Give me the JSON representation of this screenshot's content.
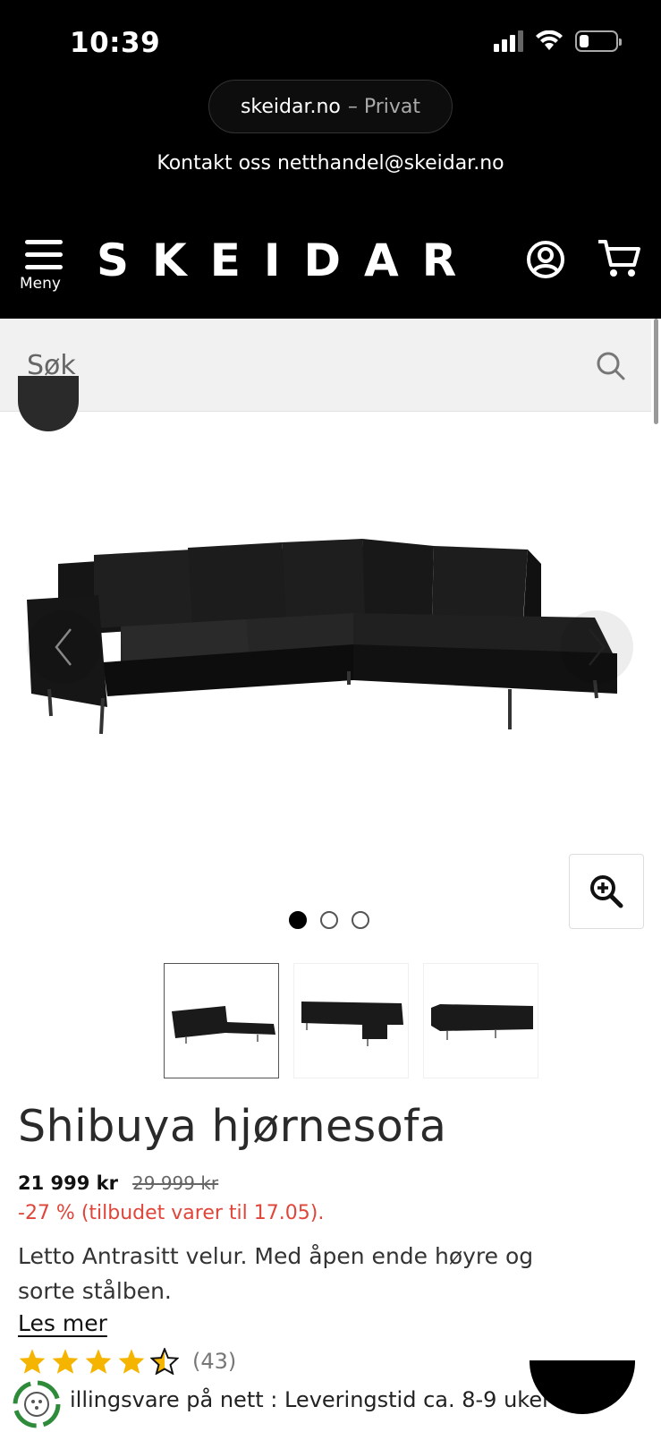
{
  "status_bar": {
    "time": "10:39"
  },
  "browser": {
    "domain": "skeidar.no",
    "mode": "– Privat"
  },
  "header": {
    "contact": "Kontakt oss netthandel@skeidar.no",
    "menu_label": "Meny",
    "logo": "SKEIDAR",
    "icons": [
      "menu-icon",
      "account-icon",
      "cart-icon"
    ]
  },
  "search": {
    "placeholder": "Søk"
  },
  "gallery": {
    "image_count": 3,
    "active_index": 0,
    "icons": [
      "chevron-left-icon",
      "chevron-right-icon",
      "zoom-in-icon"
    ]
  },
  "product": {
    "title": "Shibuya hjørnesofa",
    "price": "21 999 kr",
    "old_price": "29 999 kr",
    "discount": "-27 % (tilbudet varer til 17.05).",
    "description": "Letto Antrasitt velur. Med åpen ende høyre og sorte stålben.",
    "read_more": "Les mer",
    "rating": 4.5,
    "rating_count": "(43)"
  },
  "delivery": {
    "text": "illingsvare på nett : Leveringstid ca. 8-9 uker"
  },
  "colors": {
    "header_bg": "#000000",
    "discount": "#e0453a",
    "star": "#f5b400"
  }
}
